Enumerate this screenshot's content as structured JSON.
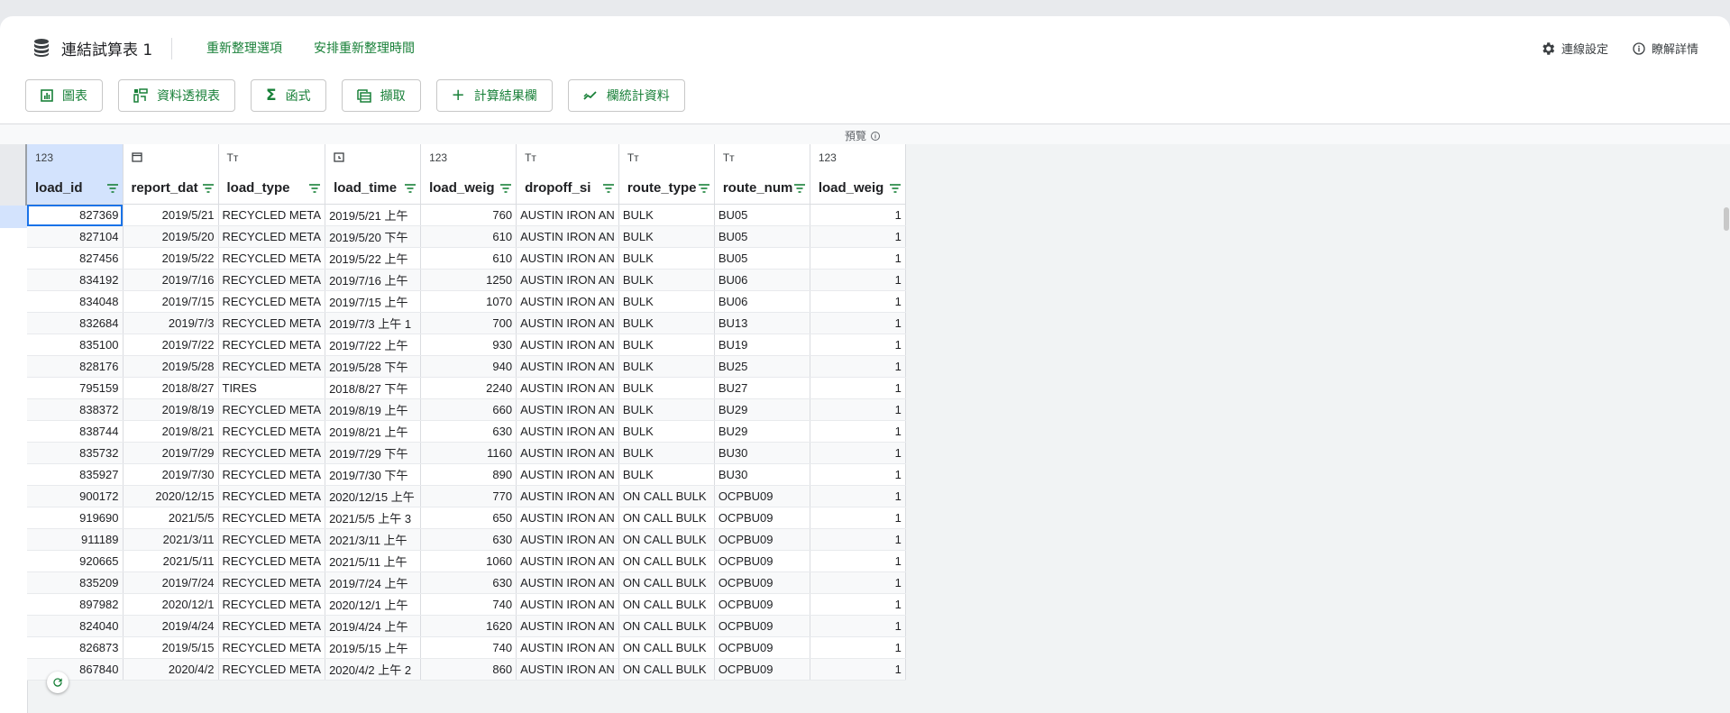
{
  "header": {
    "title": "連結試算表 1",
    "links": [
      "重新整理選項",
      "安排重新整理時間"
    ],
    "connection_settings": "連線設定",
    "learn_more": "瞭解詳情"
  },
  "toolbar": {
    "buttons": [
      "圖表",
      "資料透視表",
      "函式",
      "擷取",
      "計算結果欄",
      "欄統計資料"
    ]
  },
  "preview": {
    "label": "預覽"
  },
  "colors": {
    "accent": "#188038",
    "selection": "#d3e3fd",
    "active_border": "#1a73e8"
  },
  "columns": [
    {
      "type": "123",
      "name": "load_id"
    },
    {
      "type": "calendar-icon",
      "name": "report_dat"
    },
    {
      "type": "Tт",
      "name": "load_type"
    },
    {
      "type": "clock-icon",
      "name": "load_time"
    },
    {
      "type": "123",
      "name": "load_weig"
    },
    {
      "type": "Tт",
      "name": "dropoff_si"
    },
    {
      "type": "Tт",
      "name": "route_type"
    },
    {
      "type": "Tт",
      "name": "route_num"
    },
    {
      "type": "123",
      "name": "load_weig"
    }
  ],
  "rows": [
    [
      "827369",
      "2019/5/21",
      "RECYCLED META",
      "2019/5/21 上午",
      "760",
      "AUSTIN IRON AN",
      "BULK",
      "BU05",
      "1"
    ],
    [
      "827104",
      "2019/5/20",
      "RECYCLED META",
      "2019/5/20 下午",
      "610",
      "AUSTIN IRON AN",
      "BULK",
      "BU05",
      "1"
    ],
    [
      "827456",
      "2019/5/22",
      "RECYCLED META",
      "2019/5/22 上午",
      "610",
      "AUSTIN IRON AN",
      "BULK",
      "BU05",
      "1"
    ],
    [
      "834192",
      "2019/7/16",
      "RECYCLED META",
      "2019/7/16 上午",
      "1250",
      "AUSTIN IRON AN",
      "BULK",
      "BU06",
      "1"
    ],
    [
      "834048",
      "2019/7/15",
      "RECYCLED META",
      "2019/7/15 上午",
      "1070",
      "AUSTIN IRON AN",
      "BULK",
      "BU06",
      "1"
    ],
    [
      "832684",
      "2019/7/3",
      "RECYCLED META",
      "2019/7/3 上午 1",
      "700",
      "AUSTIN IRON AN",
      "BULK",
      "BU13",
      "1"
    ],
    [
      "835100",
      "2019/7/22",
      "RECYCLED META",
      "2019/7/22 上午",
      "930",
      "AUSTIN IRON AN",
      "BULK",
      "BU19",
      "1"
    ],
    [
      "828176",
      "2019/5/28",
      "RECYCLED META",
      "2019/5/28 下午",
      "940",
      "AUSTIN IRON AN",
      "BULK",
      "BU25",
      "1"
    ],
    [
      "795159",
      "2018/8/27",
      "TIRES",
      "2018/8/27 下午",
      "2240",
      "AUSTIN IRON AN",
      "BULK",
      "BU27",
      "1"
    ],
    [
      "838372",
      "2019/8/19",
      "RECYCLED META",
      "2019/8/19 上午",
      "660",
      "AUSTIN IRON AN",
      "BULK",
      "BU29",
      "1"
    ],
    [
      "838744",
      "2019/8/21",
      "RECYCLED META",
      "2019/8/21 上午",
      "630",
      "AUSTIN IRON AN",
      "BULK",
      "BU29",
      "1"
    ],
    [
      "835732",
      "2019/7/29",
      "RECYCLED META",
      "2019/7/29 下午",
      "1160",
      "AUSTIN IRON AN",
      "BULK",
      "BU30",
      "1"
    ],
    [
      "835927",
      "2019/7/30",
      "RECYCLED META",
      "2019/7/30 下午",
      "890",
      "AUSTIN IRON AN",
      "BULK",
      "BU30",
      "1"
    ],
    [
      "900172",
      "2020/12/15",
      "RECYCLED META",
      "2020/12/15 上午",
      "770",
      "AUSTIN IRON AN",
      "ON CALL BULK",
      "OCPBU09",
      "1"
    ],
    [
      "919690",
      "2021/5/5",
      "RECYCLED META",
      "2021/5/5 上午 3",
      "650",
      "AUSTIN IRON AN",
      "ON CALL BULK",
      "OCPBU09",
      "1"
    ],
    [
      "911189",
      "2021/3/11",
      "RECYCLED META",
      "2021/3/11 上午",
      "630",
      "AUSTIN IRON AN",
      "ON CALL BULK",
      "OCPBU09",
      "1"
    ],
    [
      "920665",
      "2021/5/11",
      "RECYCLED META",
      "2021/5/11 上午",
      "1060",
      "AUSTIN IRON AN",
      "ON CALL BULK",
      "OCPBU09",
      "1"
    ],
    [
      "835209",
      "2019/7/24",
      "RECYCLED META",
      "2019/7/24 上午",
      "630",
      "AUSTIN IRON AN",
      "ON CALL BULK",
      "OCPBU09",
      "1"
    ],
    [
      "897982",
      "2020/12/1",
      "RECYCLED META",
      "2020/12/1 上午",
      "740",
      "AUSTIN IRON AN",
      "ON CALL BULK",
      "OCPBU09",
      "1"
    ],
    [
      "824040",
      "2019/4/24",
      "RECYCLED META",
      "2019/4/24 上午",
      "1620",
      "AUSTIN IRON AN",
      "ON CALL BULK",
      "OCPBU09",
      "1"
    ],
    [
      "826873",
      "2019/5/15",
      "RECYCLED META",
      "2019/5/15 上午",
      "740",
      "AUSTIN IRON AN",
      "ON CALL BULK",
      "OCPBU09",
      "1"
    ],
    [
      "867840",
      "2020/4/2",
      "RECYCLED META",
      "2020/4/2 上午 2",
      "860",
      "AUSTIN IRON AN",
      "ON CALL BULK",
      "OCPBU09",
      "1"
    ]
  ]
}
